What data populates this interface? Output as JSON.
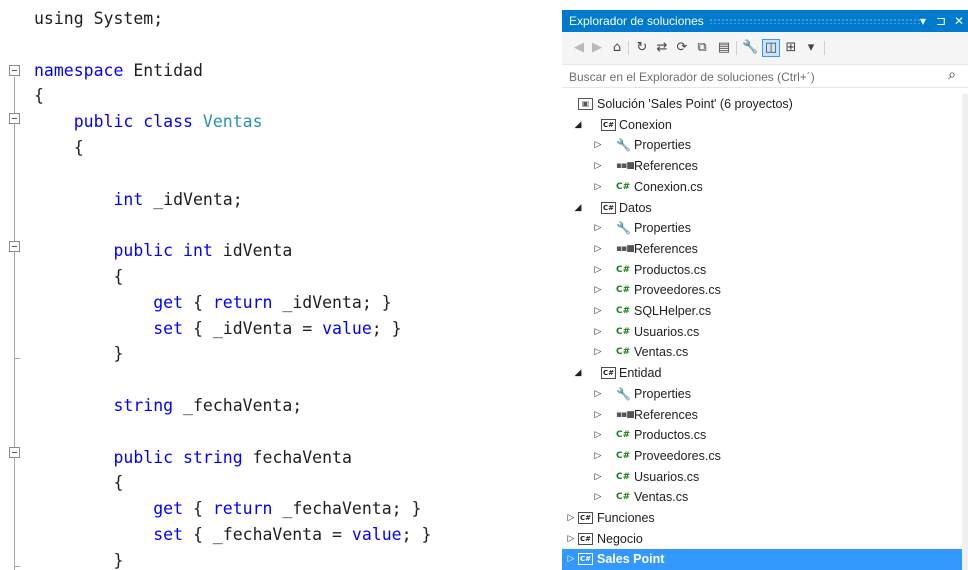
{
  "editor": {
    "lines": [
      [
        {
          "t": "using System;"
        }
      ],
      [
        {
          "t": ""
        }
      ],
      [
        {
          "t": "namespace",
          "c": "kw"
        },
        {
          "t": " Entidad"
        }
      ],
      [
        {
          "t": "{"
        }
      ],
      [
        {
          "t": "    "
        },
        {
          "t": "public",
          "c": "kw"
        },
        {
          "t": " "
        },
        {
          "t": "class",
          "c": "kw"
        },
        {
          "t": " "
        },
        {
          "t": "Ventas",
          "c": "ty"
        }
      ],
      [
        {
          "t": "    {"
        }
      ],
      [
        {
          "t": ""
        }
      ],
      [
        {
          "t": "        "
        },
        {
          "t": "int",
          "c": "kw"
        },
        {
          "t": " _idVenta;"
        }
      ],
      [
        {
          "t": ""
        }
      ],
      [
        {
          "t": "        "
        },
        {
          "t": "public",
          "c": "kw"
        },
        {
          "t": " "
        },
        {
          "t": "int",
          "c": "kw"
        },
        {
          "t": " idVenta"
        }
      ],
      [
        {
          "t": "        {"
        }
      ],
      [
        {
          "t": "            "
        },
        {
          "t": "get",
          "c": "kw"
        },
        {
          "t": " { "
        },
        {
          "t": "return",
          "c": "kw"
        },
        {
          "t": " _idVenta; }"
        }
      ],
      [
        {
          "t": "            "
        },
        {
          "t": "set",
          "c": "kw"
        },
        {
          "t": " { _idVenta = "
        },
        {
          "t": "value",
          "c": "kw"
        },
        {
          "t": "; }"
        }
      ],
      [
        {
          "t": "        }"
        }
      ],
      [
        {
          "t": ""
        }
      ],
      [
        {
          "t": "        "
        },
        {
          "t": "string",
          "c": "kw"
        },
        {
          "t": " _fechaVenta;"
        }
      ],
      [
        {
          "t": ""
        }
      ],
      [
        {
          "t": "        "
        },
        {
          "t": "public",
          "c": "kw"
        },
        {
          "t": " "
        },
        {
          "t": "string",
          "c": "kw"
        },
        {
          "t": " fechaVenta"
        }
      ],
      [
        {
          "t": "        {"
        }
      ],
      [
        {
          "t": "            "
        },
        {
          "t": "get",
          "c": "kw"
        },
        {
          "t": " { "
        },
        {
          "t": "return",
          "c": "kw"
        },
        {
          "t": " _fechaVenta; }"
        }
      ],
      [
        {
          "t": "            "
        },
        {
          "t": "set",
          "c": "kw"
        },
        {
          "t": " { _fechaVenta = "
        },
        {
          "t": "value",
          "c": "kw"
        },
        {
          "t": "; }"
        }
      ],
      [
        {
          "t": "        }"
        }
      ]
    ]
  },
  "explorer": {
    "title": "Explorador de soluciones",
    "title_buttons": [
      "▾",
      "⊐",
      "✕"
    ],
    "toolbar_icons": [
      {
        "name": "back-icon",
        "glyph": "◀",
        "enabled": false
      },
      {
        "name": "forward-icon",
        "glyph": "▶",
        "enabled": false
      },
      {
        "name": "home-icon",
        "glyph": "⌂",
        "enabled": true
      },
      {
        "name": "pending-changes-icon",
        "glyph": "↻",
        "enabled": true
      },
      {
        "name": "sync-icon",
        "glyph": "⇄",
        "enabled": true
      },
      {
        "name": "refresh-icon",
        "glyph": "⟳",
        "enabled": true
      },
      {
        "name": "collapse-all-icon",
        "glyph": "⧉",
        "enabled": true
      },
      {
        "name": "show-all-files-icon",
        "glyph": "▤",
        "enabled": true
      },
      {
        "name": "properties-icon",
        "glyph": "🔧",
        "enabled": true
      },
      {
        "name": "preview-icon",
        "glyph": "◫",
        "enabled": true
      },
      {
        "name": "view-class-diagram-icon",
        "glyph": "⊞",
        "enabled": true
      },
      {
        "name": "dropdown-icon",
        "glyph": "▾",
        "enabled": true
      }
    ],
    "search": {
      "placeholder": "Buscar en el Explorador de soluciones (Ctrl+´)",
      "icon": "search-icon"
    },
    "tree": [
      {
        "label": "Solución 'Sales Point'  (6 proyectos)",
        "indent": 0,
        "icon": "solution",
        "arrow": ""
      },
      {
        "label": "Conexion",
        "indent": 1,
        "icon": "project",
        "arrow": "expanded"
      },
      {
        "label": "Properties",
        "indent": 2,
        "icon": "wrench",
        "arrow": "collapsed"
      },
      {
        "label": "References",
        "indent": 2,
        "icon": "references",
        "arrow": "collapsed"
      },
      {
        "label": "Conexion.cs",
        "indent": 2,
        "icon": "cs",
        "arrow": "collapsed"
      },
      {
        "label": "Datos",
        "indent": 1,
        "icon": "project",
        "arrow": "expanded"
      },
      {
        "label": "Properties",
        "indent": 2,
        "icon": "wrench",
        "arrow": "collapsed"
      },
      {
        "label": "References",
        "indent": 2,
        "icon": "references",
        "arrow": "collapsed"
      },
      {
        "label": "Productos.cs",
        "indent": 2,
        "icon": "cs",
        "arrow": "collapsed"
      },
      {
        "label": "Proveedores.cs",
        "indent": 2,
        "icon": "cs",
        "arrow": "collapsed"
      },
      {
        "label": "SQLHelper.cs",
        "indent": 2,
        "icon": "cs",
        "arrow": "collapsed"
      },
      {
        "label": "Usuarios.cs",
        "indent": 2,
        "icon": "cs",
        "arrow": "collapsed"
      },
      {
        "label": "Ventas.cs",
        "indent": 2,
        "icon": "cs",
        "arrow": "collapsed"
      },
      {
        "label": "Entidad",
        "indent": 1,
        "icon": "project",
        "arrow": "expanded"
      },
      {
        "label": "Properties",
        "indent": 2,
        "icon": "wrench",
        "arrow": "collapsed"
      },
      {
        "label": "References",
        "indent": 2,
        "icon": "references",
        "arrow": "collapsed"
      },
      {
        "label": "Productos.cs",
        "indent": 2,
        "icon": "cs",
        "arrow": "collapsed"
      },
      {
        "label": "Proveedores.cs",
        "indent": 2,
        "icon": "cs",
        "arrow": "collapsed"
      },
      {
        "label": "Usuarios.cs",
        "indent": 2,
        "icon": "cs",
        "arrow": "collapsed"
      },
      {
        "label": "Ventas.cs",
        "indent": 2,
        "icon": "cs",
        "arrow": "collapsed"
      },
      {
        "label": "Funciones",
        "indent": 0,
        "icon": "project",
        "arrow": "collapsed"
      },
      {
        "label": "Negocio",
        "indent": 0,
        "icon": "project",
        "arrow": "collapsed"
      },
      {
        "label": "Sales Point",
        "indent": 0,
        "icon": "project",
        "arrow": "collapsed",
        "selected": true
      }
    ]
  },
  "colors": {
    "keyword": "#0000ff",
    "type": "#2b91af",
    "accent": "#007acc",
    "selection": "#3399ff"
  }
}
